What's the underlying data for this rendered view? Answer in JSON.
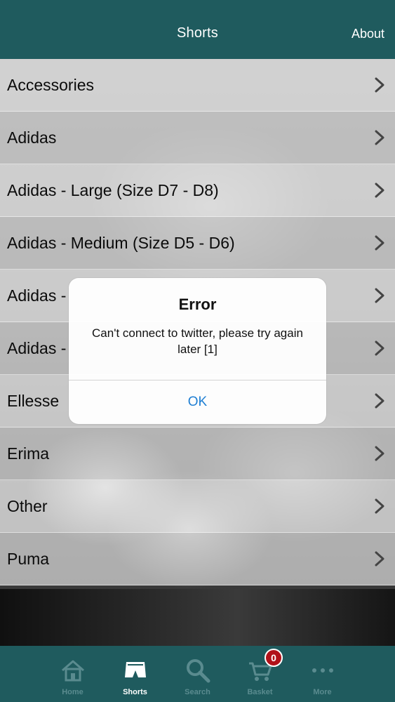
{
  "header": {
    "title": "Shorts",
    "about_label": "About"
  },
  "list": {
    "items": [
      {
        "label": "Accessories"
      },
      {
        "label": "Adidas"
      },
      {
        "label": "Adidas - Large (Size D7 - D8)"
      },
      {
        "label": "Adidas - Medium (Size D5 - D6)"
      },
      {
        "label": "Adidas -"
      },
      {
        "label": "Adidas -"
      },
      {
        "label": "Ellesse"
      },
      {
        "label": "Erima"
      },
      {
        "label": "Other"
      },
      {
        "label": "Puma"
      }
    ],
    "chevron_icon": "chevron-right-icon"
  },
  "alert": {
    "title": "Error",
    "message": "Can't connect to twitter, please try again later [1]",
    "ok_label": "OK"
  },
  "tabbar": {
    "tabs": [
      {
        "label": "Home",
        "icon": "home-icon",
        "active": false
      },
      {
        "label": "Shorts",
        "icon": "shorts-icon",
        "active": true
      },
      {
        "label": "Search",
        "icon": "search-icon",
        "active": false
      },
      {
        "label": "Basket",
        "icon": "basket-icon",
        "active": false,
        "badge": "0"
      },
      {
        "label": "More",
        "icon": "more-icon",
        "active": false
      }
    ]
  },
  "colors": {
    "header_bg": "#1f5b5e",
    "tab_inactive": "#5a8b8f",
    "tab_active": "#ffffff",
    "alert_button": "#1f7fd3",
    "badge_bg": "#b1121a"
  }
}
